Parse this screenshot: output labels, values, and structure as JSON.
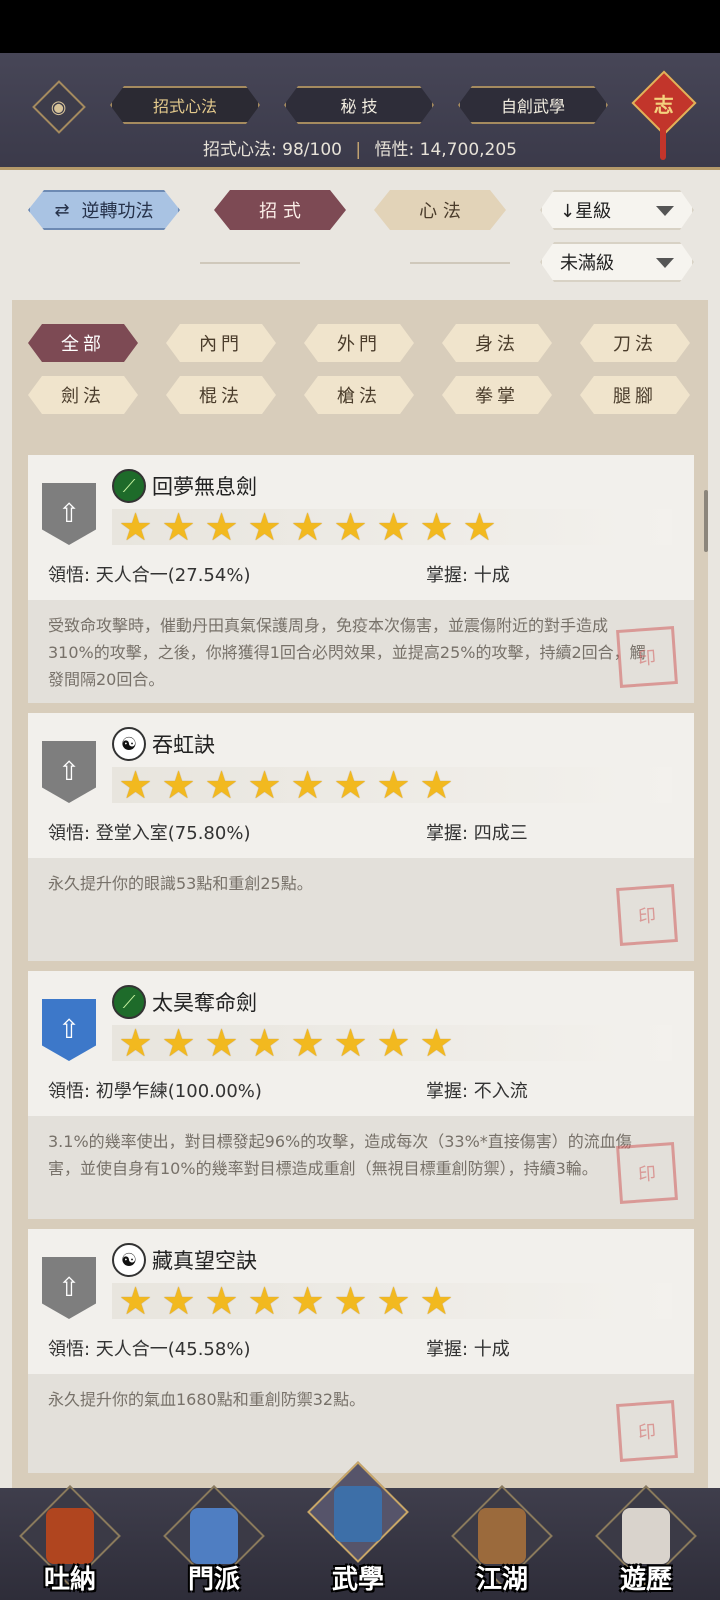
{
  "header": {
    "tabs": [
      {
        "label": "招式心法",
        "active": true
      },
      {
        "label": "秘 技",
        "active": false
      },
      {
        "label": "自創武學",
        "active": false
      }
    ],
    "stats_left": "招式心法: 98/100",
    "stats_sep": "|",
    "stats_right": "悟性: 14,700,205",
    "charm_char": "志"
  },
  "toolbar": {
    "reverse_label": "逆轉功法",
    "mode_tabs": [
      {
        "label": "招 式",
        "active": true
      },
      {
        "label": "心 法",
        "active": false
      }
    ],
    "sort_select": "↓星級",
    "filter_select": "未滿級"
  },
  "categories": [
    {
      "label": "全部",
      "active": true
    },
    {
      "label": "內門",
      "active": false
    },
    {
      "label": "外門",
      "active": false
    },
    {
      "label": "身法",
      "active": false
    },
    {
      "label": "刀法",
      "active": false
    },
    {
      "label": "劍法",
      "active": false
    },
    {
      "label": "棍法",
      "active": false
    },
    {
      "label": "槍法",
      "active": false
    },
    {
      "label": "拳掌",
      "active": false
    },
    {
      "label": "腿腳",
      "active": false
    }
  ],
  "skills": [
    {
      "name": "回夢無息劍",
      "type_icon": "sword-icon",
      "badge": "grey",
      "stars": 9,
      "corner_icon": "gear-icon",
      "comprehension": "領悟: 天人合一(27.54%)",
      "mastery": "掌握: 十成",
      "description": "受致命攻擊時，催動丹田真氣保護周身，免疫本次傷害，並震傷附近的對手造成310%的攻擊，之後，你將獲得1回合必閃效果，並提高25%的攻擊，持續2回合，觸發間隔20回合。"
    },
    {
      "name": "吞虹訣",
      "type_icon": "taiji-icon",
      "badge": "grey",
      "stars": 8,
      "corner_icon": "tower-icon",
      "comprehension": "領悟: 登堂入室(75.80%)",
      "mastery": "掌握: 四成三",
      "description": "永久提升你的眼識53點和重創25點。"
    },
    {
      "name": "太昊奪命劍",
      "type_icon": "sword-icon",
      "badge": "blue",
      "stars": 8,
      "corner_icon": "",
      "comprehension": "領悟: 初學乍練(100.00%)",
      "mastery": "掌握: 不入流",
      "description": "3.1%的幾率使出，對目標發起96%的攻擊，造成每次（33%*直接傷害）的流血傷害，並使自身有10%的幾率對目標造成重創（無視目標重創防禦），持續3輪。"
    },
    {
      "name": "藏真望空訣",
      "type_icon": "taiji-icon",
      "badge": "grey",
      "stars": 8,
      "corner_icon": "",
      "comprehension": "領悟: 天人合一(45.58%)",
      "mastery": "掌握: 十成",
      "description": "永久提升你的氣血1680點和重創防禦32點。"
    }
  ],
  "bottom_nav": [
    {
      "label": "吐納",
      "active": false,
      "color": "#b0451f"
    },
    {
      "label": "門派",
      "active": false,
      "color": "#4f7ec2"
    },
    {
      "label": "武學",
      "active": true,
      "color": "#3d6fa8"
    },
    {
      "label": "江湖",
      "active": false,
      "color": "#9b6a3c"
    },
    {
      "label": "遊歷",
      "active": false,
      "color": "#d9d3cc"
    }
  ],
  "colors": {
    "accent_maroon": "#7d4a54",
    "gold": "#f2b91f",
    "header_bg": "#474657"
  }
}
